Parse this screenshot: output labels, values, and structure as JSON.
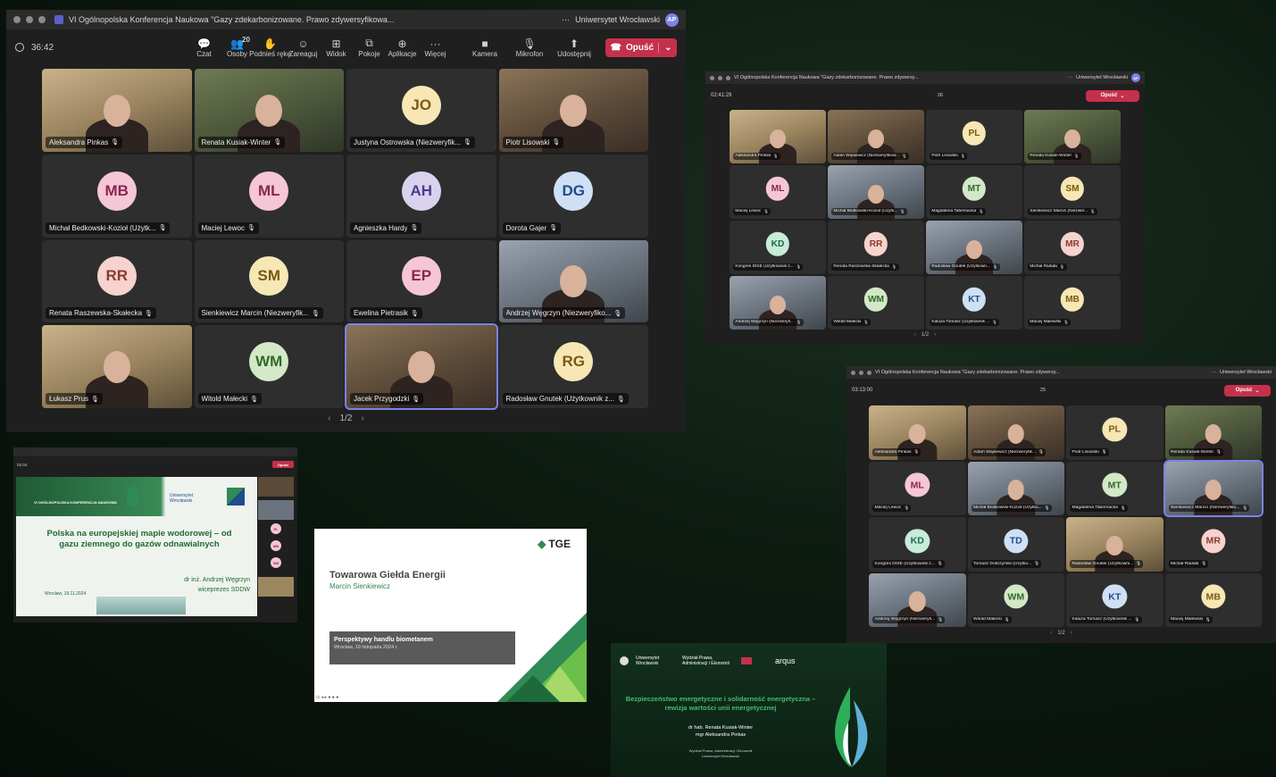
{
  "main": {
    "title": "VI Ogólnopolska Konferencja Naukowa \"Gazy zdekarbonizowane. Prawo zdywersyfikowa...",
    "more": "···",
    "org": "Uniwersytet Wrocławski",
    "org_avatar": "AP",
    "timer": "36:42",
    "tools": [
      {
        "icon": "chat-icon",
        "glyph": "💬",
        "label": "Czat"
      },
      {
        "icon": "people-icon",
        "glyph": "👥",
        "count": "20",
        "label": "Osoby"
      },
      {
        "icon": "raise-hand-icon",
        "glyph": "✋",
        "label": "Podnieś rękę"
      },
      {
        "icon": "react-icon",
        "glyph": "☺",
        "label": "Zareaguj"
      },
      {
        "icon": "view-icon",
        "glyph": "⊞",
        "label": "Widok"
      },
      {
        "icon": "rooms-icon",
        "glyph": "⧉",
        "label": "Pokoje"
      },
      {
        "icon": "apps-icon",
        "glyph": "⊕",
        "label": "Aplikacje"
      },
      {
        "icon": "more-icon",
        "glyph": "···",
        "label": "Więcej"
      },
      {
        "icon": "camera-icon",
        "glyph": "■",
        "label": "Kamera"
      },
      {
        "icon": "mic-off-icon",
        "glyph": "🎙",
        "label": "Mikrofon"
      },
      {
        "icon": "share-icon",
        "glyph": "⬆",
        "label": "Udostępnij"
      }
    ],
    "leave": "Opuść",
    "tiles": [
      {
        "kind": "video",
        "v": "v4",
        "name": "Aleksandra Pinkas"
      },
      {
        "kind": "video",
        "v": "v2",
        "name": "Renata Kusiak-Winter"
      },
      {
        "kind": "avatar",
        "initials": "JO",
        "cls": "p-yel",
        "name": "Justyna Ostrowska (Niezweryfik..."
      },
      {
        "kind": "video",
        "v": "v1",
        "name": "Piotr Lisowski"
      },
      {
        "kind": "avatar",
        "initials": "MB",
        "cls": "p-pink",
        "name": "Michał Bedkowski-Kozioł (Użytk..."
      },
      {
        "kind": "avatar",
        "initials": "ML",
        "cls": "p-pink",
        "name": "Maciej Lewoc"
      },
      {
        "kind": "avatar",
        "initials": "AH",
        "cls": "p-purple",
        "name": "Agnieszka Hardy"
      },
      {
        "kind": "avatar",
        "initials": "DG",
        "cls": "p-blue",
        "name": "Dorota Gajer"
      },
      {
        "kind": "avatar",
        "initials": "RR",
        "cls": "p-rose",
        "name": "Renata Raszewska-Skałecka"
      },
      {
        "kind": "avatar",
        "initials": "SM",
        "cls": "p-yel",
        "name": "Sienkiewicz Marcin (Niezweryfik..."
      },
      {
        "kind": "avatar",
        "initials": "EP",
        "cls": "p-pink",
        "name": "Ewelina Pietrasik"
      },
      {
        "kind": "video",
        "v": "v3",
        "name": "Andrzej Węgrzyn (Niezweryfiko..."
      },
      {
        "kind": "video",
        "v": "v4",
        "name": "Łukasz Prus"
      },
      {
        "kind": "avatar",
        "initials": "WM",
        "cls": "p-sage",
        "name": "Witold Małecki"
      },
      {
        "kind": "video",
        "v": "v1",
        "name": "Jacek Przygodzki",
        "sel": true
      },
      {
        "kind": "avatar",
        "initials": "RG",
        "cls": "p-yel",
        "name": "Radosław Gnutek (Użytkownik z..."
      }
    ],
    "pager": "1/2"
  },
  "w2": {
    "title": "VI Ogólnopolska Konferencja Naukowa \"Gazy zdekarbonizowane. Prawo zdywersy...",
    "more": "···",
    "org": "Uniwersytet Wrocławski",
    "org_avatar": "AP",
    "timer": "02:41:29",
    "count": "26",
    "leave": "Opuść",
    "tiles": [
      {
        "kind": "video",
        "v": "v4",
        "name": "Aleksandra Pinkas"
      },
      {
        "kind": "video",
        "v": "v1",
        "name": "Adam Wąsiewicz (Niezweryfikow..."
      },
      {
        "kind": "avatar",
        "initials": "PL",
        "cls": "p-yel",
        "name": "Piotr Lisowski"
      },
      {
        "kind": "video",
        "v": "v2",
        "name": "Renata Kusiak-Winter"
      },
      {
        "kind": "avatar",
        "initials": "ML",
        "cls": "p-pink",
        "name": "Maciej Lewoc"
      },
      {
        "kind": "video",
        "v": "v3",
        "name": "Michał Bedkowski-Kozioł (Użytk..."
      },
      {
        "kind": "avatar",
        "initials": "MT",
        "cls": "p-sage",
        "name": "Magdalena Tabernacka"
      },
      {
        "kind": "avatar",
        "initials": "SM",
        "cls": "p-yel",
        "name": "Sienkiewicz Marcin (Niezwer..."
      },
      {
        "kind": "avatar",
        "initials": "KD",
        "cls": "p-mint",
        "name": "Kongres DISE (Użytkownik z..."
      },
      {
        "kind": "avatar",
        "initials": "RR",
        "cls": "p-rose",
        "name": "Renata Raszewska-Skałecka"
      },
      {
        "kind": "video",
        "v": "v3",
        "name": "Radosław Gnutek (Użytkown..."
      },
      {
        "kind": "avatar",
        "initials": "MR",
        "cls": "p-rose",
        "name": "Michał Raduła"
      },
      {
        "kind": "video",
        "v": "v3",
        "name": "Andrzej Węgrzyn (Niezweryfi..."
      },
      {
        "kind": "avatar",
        "initials": "WM",
        "cls": "p-sage",
        "name": "Witold Małecki"
      },
      {
        "kind": "avatar",
        "initials": "KT",
        "cls": "p-blue",
        "name": "Kaluza Tomasz (Użytkownik ..."
      },
      {
        "kind": "avatar",
        "initials": "MB",
        "cls": "p-yel",
        "name": "Maciej Malewski"
      }
    ],
    "pager": "1/2"
  },
  "w3": {
    "title": "VI Ogólnopolska Konferencja Naukowa \"Gazy zdekarbonizowane. Prawo zdywersy...",
    "more": "···",
    "org": "Uniwersytet Wrocławski",
    "timer": "03:13:00",
    "count": "25",
    "leave": "Opuść",
    "tiles": [
      {
        "kind": "video",
        "v": "v4",
        "name": "Aleksandra Pinkas"
      },
      {
        "kind": "video",
        "v": "v1",
        "name": "Adam Wąsiewicz (Niezweryfik..."
      },
      {
        "kind": "avatar",
        "initials": "PL",
        "cls": "p-yel",
        "name": "Piotr Lisowski"
      },
      {
        "kind": "video",
        "v": "v2",
        "name": "Renata Kusiak-Winter"
      },
      {
        "kind": "avatar",
        "initials": "ML",
        "cls": "p-pink",
        "name": "Maciej Lewoc"
      },
      {
        "kind": "video",
        "v": "v3",
        "name": "Michał Bedkowski-Kozioł (Użytko..."
      },
      {
        "kind": "avatar",
        "initials": "MT",
        "cls": "p-sage",
        "name": "Magdalena Tabernacka"
      },
      {
        "kind": "video",
        "v": "v3",
        "name": "Sienkiewicz Marcin (Niezweryfiko...",
        "sel": true
      },
      {
        "kind": "avatar",
        "initials": "KD",
        "cls": "p-mint",
        "name": "Kongres DISE (Użytkownik z..."
      },
      {
        "kind": "avatar",
        "initials": "TD",
        "cls": "p-blue",
        "name": "Tomasz Dobrzyński (Użytko..."
      },
      {
        "kind": "video",
        "v": "v4",
        "name": "Radosław Gnutek (Użytkowni..."
      },
      {
        "kind": "avatar",
        "initials": "MR",
        "cls": "p-rose",
        "name": "Michał Raduła"
      },
      {
        "kind": "video",
        "v": "v3",
        "name": "Andrzej Węgrzyn (Niezweryfi..."
      },
      {
        "kind": "avatar",
        "initials": "WM",
        "cls": "p-sage",
        "name": "Witold Małecki"
      },
      {
        "kind": "avatar",
        "initials": "KT",
        "cls": "p-blue",
        "name": "Kaluza Tomasz (Użytkownik ..."
      },
      {
        "kind": "avatar",
        "initials": "MB",
        "cls": "p-yel",
        "name": "Maciej Malewski"
      }
    ],
    "pager": "1/2"
  },
  "slide1": {
    "header_text": "VI OGÓLNOPOLSKA KONFERENCJA NAUKOWA",
    "uni": "Uniwersytet Wrocławski",
    "title": "Polska na europejskiej mapie wodorowej – od gazu ziemnego do gazów odnawialnych",
    "author": "dr inż. Andrzej Węgrzyn",
    "role": "wiceprezes SDDW",
    "date": "Wrocław, 19.11.2024",
    "timer": "02:04",
    "leave": "Opuść",
    "sidebar_avatars": [
      "PL",
      "MB",
      "SM"
    ]
  },
  "slide2": {
    "brand": "TGE",
    "title": "Towarowa Giełda Energii",
    "author": "Marcin Sienkiewicz",
    "subtitle": "Perspektywy handlu biometanem",
    "date": "Wrocław, 19 listopada 2024 r."
  },
  "slide3": {
    "uni": "Uniwersytet Wrocławski",
    "faculty": "Wydział Prawa, Administracji i Ekonomii",
    "arqus": "arqus",
    "title": "Bezpieczeństwo energetyczne i solidarność energetyczna – rewizja wartości unii energetycznej",
    "author1": "dr hab. Renata Kusiak-Winter",
    "author2": "mgr Aleksandra Pinkas",
    "footer1": "Wydział Prawa, Administracji i Ekonomii",
    "footer2": "Uniwersytet Wrocławski"
  },
  "colors": {
    "leave": "#c4314b",
    "accent": "#7b83eb",
    "window": "#1f1f1f"
  }
}
